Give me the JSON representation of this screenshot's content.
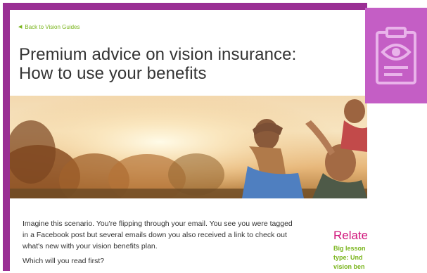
{
  "nav": {
    "back_label": "Back to Vision Guides",
    "back_icon": "chevron-left-icon"
  },
  "article": {
    "title_line1": "Premium advice on vision insurance:",
    "title_line2": "How to use your benefits",
    "hero_image": "family-outdoors-sunset-photo",
    "intro": "Imagine this scenario. You're flipping through your email. You see you were tagged in a Facebook post but several emails down you also received a link to check out what's new with your vision benefits plan.",
    "question": "Which will you read first?"
  },
  "related": {
    "heading": "Relate",
    "line1": "Big lesson",
    "line2": "type: Und",
    "line3": "vision ben"
  },
  "badge": {
    "icon": "clipboard-eye-icon"
  },
  "colors": {
    "frame": "#9a2f94",
    "badge": "#c45ec5",
    "link": "#7ab51d",
    "related_heading": "#d0157b",
    "text": "#333333"
  }
}
